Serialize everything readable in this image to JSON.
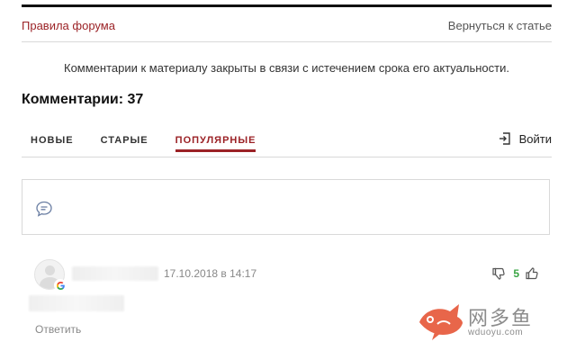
{
  "header": {
    "forum_rules": "Правила форума",
    "back_to_article": "Вернуться к статье"
  },
  "notice": "Комментарии к материалу закрыты в связи с истечением срока его актуальности.",
  "comments_title": "Комментарии: 37",
  "tabs": [
    {
      "label": "НОВЫЕ",
      "active": false
    },
    {
      "label": "СТАРЫЕ",
      "active": false
    },
    {
      "label": "ПОПУЛЯРНЫЕ",
      "active": true
    }
  ],
  "login": {
    "label": "Войти",
    "icon": "login-icon"
  },
  "comment_input": {
    "icon": "speech-bubble-icon"
  },
  "comments": [
    {
      "timestamp": "17.10.2018 в 14:17",
      "votes": "5",
      "provider_icon": "google-icon",
      "reply_label": "Ответить"
    }
  ],
  "watermark": {
    "brand_cn": "网多鱼",
    "url": "wduoyu.com"
  },
  "colors": {
    "accent": "#9b2226",
    "vote_positive": "#3aa544",
    "watermark_fish": "#e8664a"
  }
}
